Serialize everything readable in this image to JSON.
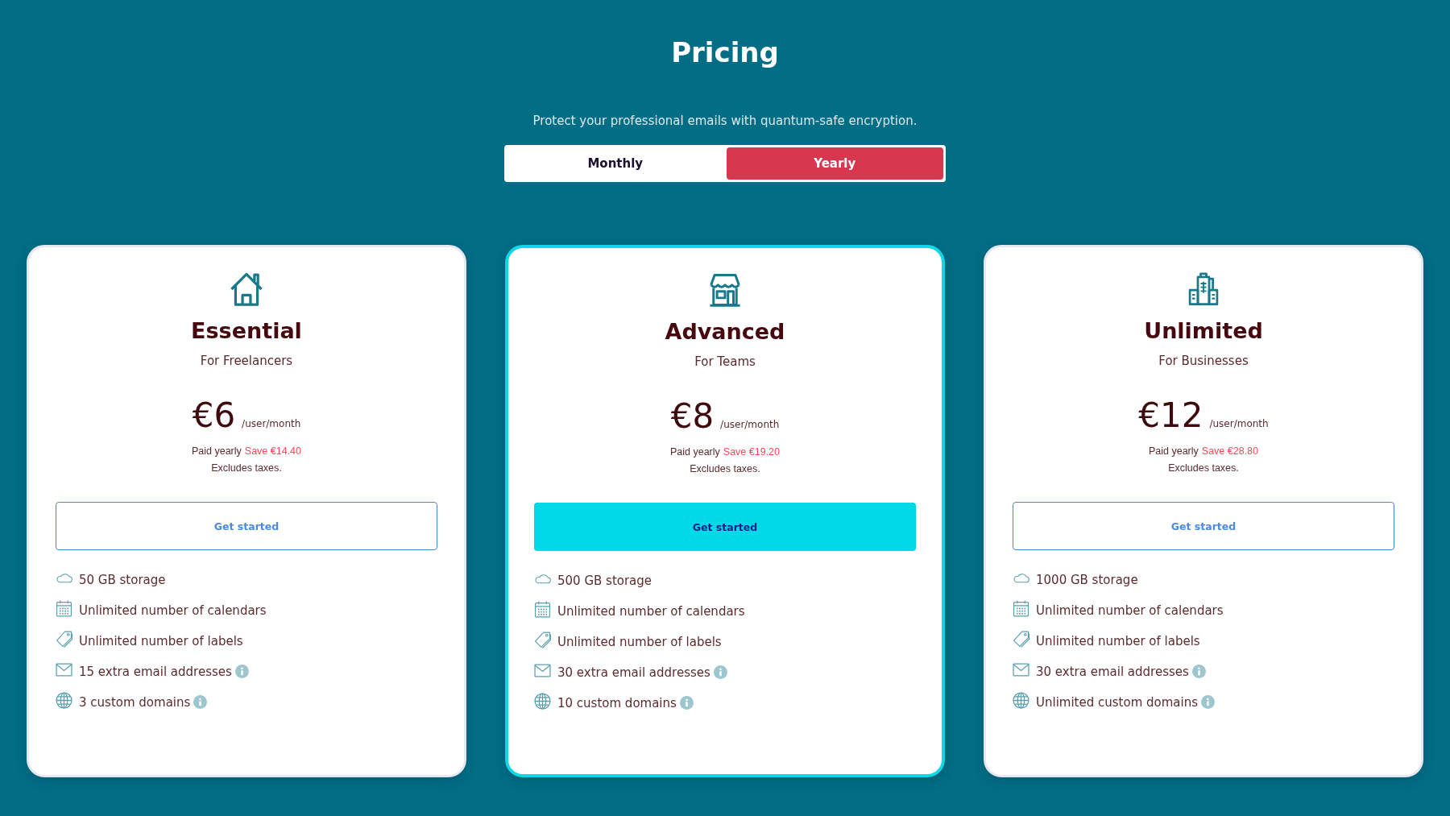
{
  "title": "Pricing",
  "subtitle": "Protect your professional emails with quantum-safe encryption.",
  "billing_toggle": [
    {
      "label": "Monthly",
      "selected": false
    },
    {
      "label": "Yearly",
      "selected": true
    }
  ],
  "plans": [
    {
      "name": "Essential",
      "audience": "For Freelancers",
      "price": "€6",
      "price_unit": "/user/month",
      "billing_note": "Paid yearly",
      "savings": "Save €14.40",
      "tax_note": "Excludes taxes.",
      "button": "Get started",
      "featured": false,
      "features": [
        {
          "text": "50 GB storage",
          "has_info": false
        },
        {
          "text": "Unlimited number of calendars",
          "has_info": false
        },
        {
          "text": "Unlimited number of labels",
          "has_info": false
        },
        {
          "text": "15 extra email addresses",
          "has_info": true
        },
        {
          "text": "3 custom domains",
          "has_info": true
        }
      ]
    },
    {
      "name": "Advanced",
      "audience": "For Teams",
      "price": "€8",
      "price_unit": "/user/month",
      "billing_note": "Paid yearly",
      "savings": "Save €19.20",
      "tax_note": "Excludes taxes.",
      "button": "Get started",
      "featured": true,
      "features": [
        {
          "text": "500 GB storage",
          "has_info": false
        },
        {
          "text": "Unlimited number of calendars",
          "has_info": false
        },
        {
          "text": "Unlimited number of labels",
          "has_info": false
        },
        {
          "text": "30 extra email addresses",
          "has_info": true
        },
        {
          "text": "10 custom domains",
          "has_info": true
        }
      ]
    },
    {
      "name": "Unlimited",
      "audience": "For Businesses",
      "price": "€12",
      "price_unit": "/user/month",
      "billing_note": "Paid yearly",
      "savings": "Save €28.80",
      "tax_note": "Excludes taxes.",
      "button": "Get started",
      "featured": false,
      "features": [
        {
          "text": "1000 GB storage",
          "has_info": false
        },
        {
          "text": "Unlimited number of calendars",
          "has_info": false
        },
        {
          "text": "Unlimited number of labels",
          "has_info": false
        },
        {
          "text": "30 extra email addresses",
          "has_info": true
        },
        {
          "text": "Unlimited custom domains",
          "has_info": true
        }
      ]
    }
  ]
}
